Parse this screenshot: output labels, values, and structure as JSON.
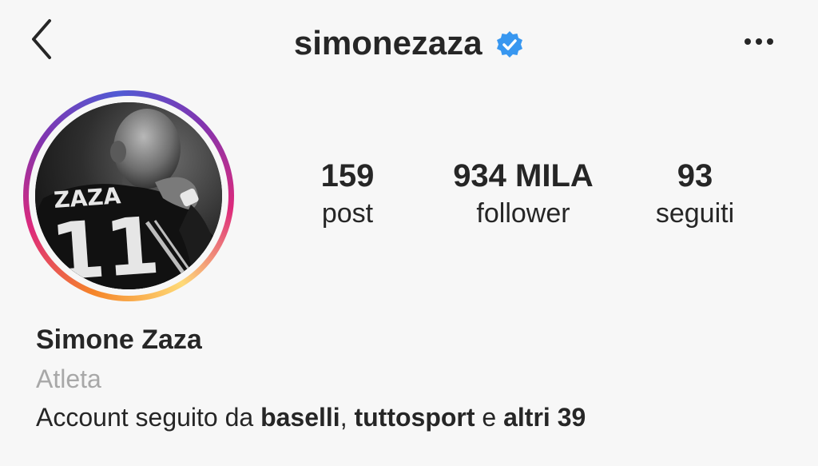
{
  "header": {
    "username": "simonezaza",
    "verified_color": "#3897f0"
  },
  "profile": {
    "avatar_ring_colors": [
      "#feda77",
      "#f58529",
      "#dd2a7b",
      "#8134af",
      "#515bd4"
    ],
    "avatar_jersey_name": "ZAZA",
    "avatar_jersey_number": "11"
  },
  "stats": {
    "posts_count": "159",
    "posts_label": "post",
    "followers_count": "934 MILA",
    "followers_label": "follower",
    "following_count": "93",
    "following_label": "seguiti"
  },
  "bio": {
    "full_name": "Simone Zaza",
    "category": "Atleta",
    "followed_by_prefix": "Account seguito da ",
    "followed_by_user1": "baselli",
    "followed_by_sep": ", ",
    "followed_by_user2": "tuttosport",
    "followed_by_and": " e ",
    "followed_by_others": "altri 39"
  },
  "icons": {
    "back": "chevron-left-icon",
    "verified": "verified-badge-icon",
    "more": "more-horizontal-icon"
  }
}
